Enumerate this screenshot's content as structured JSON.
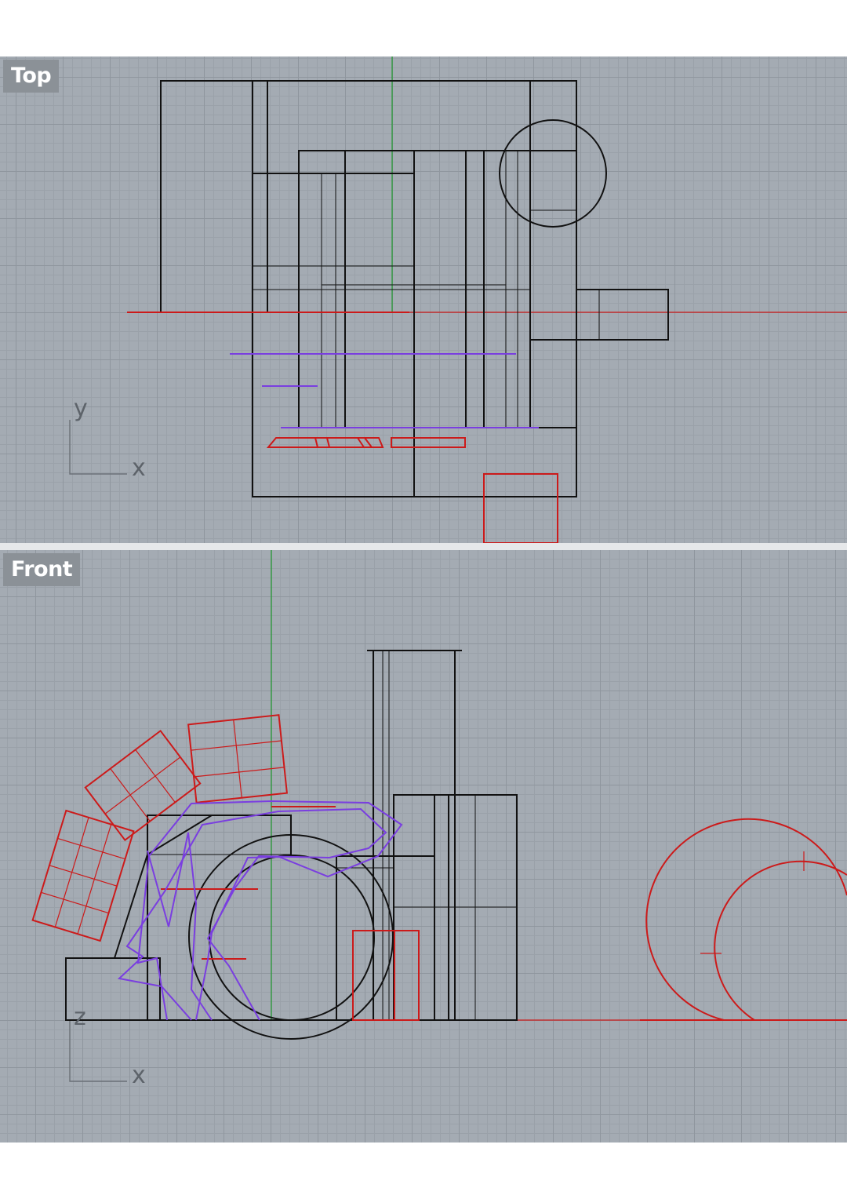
{
  "viewports": {
    "top": {
      "label": "Top",
      "axis_horizontal": "x",
      "axis_vertical": "y"
    },
    "front": {
      "label": "Front",
      "axis_horizontal": "x",
      "axis_vertical": "z"
    }
  },
  "colors": {
    "background": "#a4abb3",
    "grid_major": "#8f969e",
    "grid_minor": "#9aa1a9",
    "curve_black": "#111111",
    "curve_red": "#cc1a1a",
    "curve_purple": "#7a3ee0",
    "world_y_axis": "#1e9a2e",
    "label_bg": "#8b9197"
  }
}
